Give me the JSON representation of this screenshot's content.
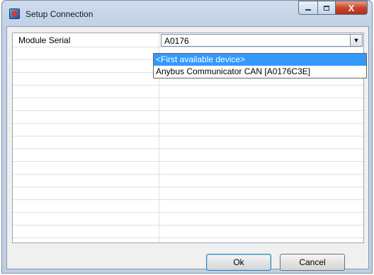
{
  "window": {
    "title": "Setup Connection"
  },
  "caption_buttons": {
    "close_glyph": "X"
  },
  "form": {
    "rows": [
      {
        "label": "Module Serial",
        "value": "A0176"
      }
    ],
    "empty_row_count": 17
  },
  "dropdown": {
    "options": [
      "<First available device>",
      "Anybus Communicator CAN [A0176C3E]"
    ],
    "highlighted_index": 0
  },
  "buttons": {
    "ok_label": "Ok",
    "cancel_label": "Cancel"
  },
  "colors": {
    "selection": "#3399ff",
    "close_button": "#c8452b"
  }
}
